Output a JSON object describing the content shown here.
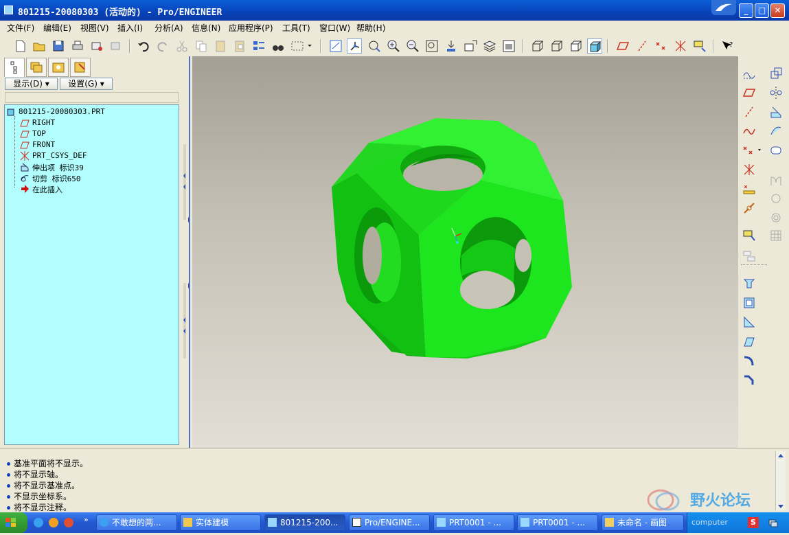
{
  "window": {
    "title": "801215-20080303 (活动的) - Pro/ENGINEER",
    "controls": {
      "minimize": "_",
      "maximize": "□",
      "close": "✕"
    }
  },
  "menu": [
    "文件(F)",
    "编辑(E)",
    "视图(V)",
    "插入(I)",
    "分析(A)",
    "信息(N)",
    "应用程序(P)",
    "工具(T)",
    "窗口(W)",
    "帮助(H)"
  ],
  "navigator": {
    "display_button": "显示(D)",
    "settings_button": "设置(G)",
    "tree": [
      {
        "label": "801215-20080303.PRT",
        "icon": "part-icon",
        "level": 0
      },
      {
        "label": "RIGHT",
        "icon": "datum-plane-icon",
        "level": 1
      },
      {
        "label": "TOP",
        "icon": "datum-plane-icon",
        "level": 1
      },
      {
        "label": "FRONT",
        "icon": "datum-plane-icon",
        "level": 1
      },
      {
        "label": "PRT_CSYS_DEF",
        "icon": "csys-icon",
        "level": 1
      },
      {
        "label": "伸出项 标识39",
        "icon": "extrude-icon",
        "level": 1
      },
      {
        "label": "切剪 标识650",
        "icon": "cut-icon",
        "level": 1
      },
      {
        "label": "在此插入",
        "icon": "insert-arrow-icon",
        "level": 1
      }
    ]
  },
  "messages": [
    "基准平面将不显示。",
    "将不显示轴。",
    "将不显示基准点。",
    "不显示坐标系。",
    "将不显示注释。"
  ],
  "taskbar": {
    "tasks": [
      {
        "label": "不敢想的两...",
        "icon": "ie-icon"
      },
      {
        "label": "实体建模",
        "icon": "folder-icon"
      },
      {
        "label": "801215-200...",
        "icon": "proe-icon",
        "active": true
      },
      {
        "label": "Pro/ENGINE...",
        "icon": "proe-window-icon"
      },
      {
        "label": "PRT0001 - ...",
        "icon": "proe-icon"
      },
      {
        "label": "PRT0001 - ...",
        "icon": "proe-icon"
      },
      {
        "label": "未命名 - 画图",
        "icon": "paint-icon"
      }
    ],
    "tray_text": "computer"
  },
  "watermark": {
    "text": "野火论坛"
  },
  "colors": {
    "model": "#19e619",
    "tree_bg": "#b2fefe",
    "titlebar": "#0a54d0"
  }
}
